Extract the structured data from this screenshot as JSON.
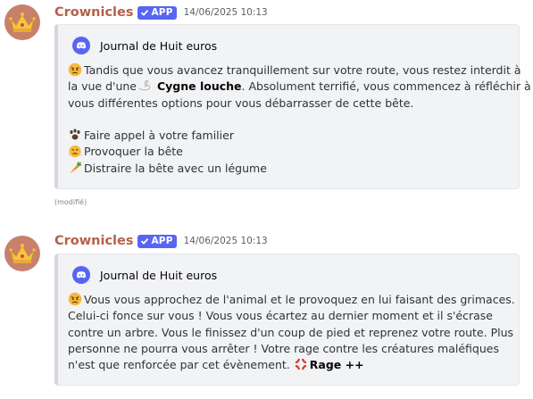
{
  "messages": [
    {
      "username": "Crownicles",
      "badge": "APP",
      "timestamp": "14/06/2025 10:13",
      "embed_author": "Journal de Huit euros",
      "lines": [
        {
          "pre": "Tandis que vous avancez tranquillement sur votre route, vous restez interdit à"
        },
        {
          "pre": "la vue d'une",
          "bold": "Cygne louche",
          "post": ". Absolument terrifié, vous commencez à réfléchir à"
        },
        {
          "pre": "vous différentes options pour vous débarrasser de cette bête."
        }
      ],
      "options": [
        {
          "icon": "paw-prints-icon",
          "label": "Faire appel à votre familier"
        },
        {
          "icon": "face-with-steam-icon",
          "label": "Provoquer la bête"
        },
        {
          "icon": "carrot-icon",
          "label": "Distraire la bête avec un légume"
        }
      ],
      "edited_label": "(modifié)"
    },
    {
      "username": "Crownicles",
      "badge": "APP",
      "timestamp": "14/06/2025 10:13",
      "embed_author": "Journal de Huit euros",
      "lines": [
        {
          "pre": "Vous vous approchez de l'animal et le provoquez en lui faisant des grimaces."
        },
        {
          "pre": "Celui-ci fonce sur vous ! Vous vous écartez au dernier moment et il s'écrase"
        },
        {
          "pre": "contre un arbre. Vous le finissez d'un coup de pied et reprenez votre route. Plus"
        },
        {
          "pre": "personne ne pourra vous arrêter ! Votre rage contre les créatures maléfiques"
        },
        {
          "pre": "n'est que renforcée par cet évènement.",
          "bold": "Rage ++"
        }
      ]
    }
  ],
  "colors": {
    "username": "#b5604a",
    "badge": "#5865f2",
    "embed_background": "#f2f3f5",
    "embed_border": "#d4d7dc"
  },
  "icons": [
    "crown-avatar-icon",
    "verified-check-icon",
    "discord-icon",
    "angry-face-icon",
    "swan-icon",
    "paw-prints-icon",
    "face-with-steam-icon",
    "carrot-icon",
    "anger-symbol-icon"
  ]
}
